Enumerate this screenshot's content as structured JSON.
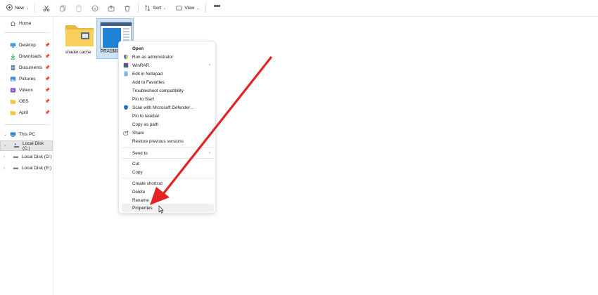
{
  "toolbar": {
    "new_label": "New",
    "sort_label": "Sort",
    "view_label": "View"
  },
  "sidebar": {
    "home": "Home",
    "quick_access": [
      {
        "label": "Desktop",
        "icon": "desktop-icon"
      },
      {
        "label": "Downloads",
        "icon": "downloads-icon"
      },
      {
        "label": "Documents",
        "icon": "documents-icon"
      },
      {
        "label": "Pictures",
        "icon": "pictures-icon"
      },
      {
        "label": "Videos",
        "icon": "videos-icon"
      },
      {
        "label": "OBS",
        "icon": "folder-icon"
      },
      {
        "label": "April",
        "icon": "folder-icon"
      }
    ],
    "this_pc": "This PC",
    "drives": [
      {
        "label": "Local Disk (C:)"
      },
      {
        "label": "Local Disk (D:)"
      },
      {
        "label": "Local Disk (E:)"
      }
    ]
  },
  "files": [
    {
      "label": "shader.cache",
      "icon": "folder-icon"
    },
    {
      "label": "PRAGMA",
      "icon": "document-file-icon"
    }
  ],
  "context_menu": {
    "items": [
      {
        "label": "Open"
      },
      {
        "label": "Run as administrator",
        "icon": "shield-icon"
      },
      {
        "label": "WinRAR",
        "icon": "winrar-icon",
        "submenu": true
      },
      {
        "label": "Edit in Notepad",
        "icon": "notepad-icon"
      },
      {
        "label": "Add to Favorites"
      },
      {
        "label": "Troubleshoot compatibility"
      },
      {
        "label": "Pin to Start"
      },
      {
        "label": "Scan with Microsoft Defender...",
        "icon": "defender-icon"
      },
      {
        "label": "Pin to taskbar"
      },
      {
        "label": "Copy as path"
      },
      {
        "label": "Share",
        "icon": "share-icon"
      },
      {
        "label": "Restore previous versions"
      },
      {
        "label": "Send to",
        "submenu": true
      },
      {
        "label": "Cut"
      },
      {
        "label": "Copy"
      },
      {
        "label": "Create shortcut"
      },
      {
        "label": "Delete"
      },
      {
        "label": "Rename"
      },
      {
        "label": "Properties"
      }
    ]
  },
  "colors": {
    "accent": "#0067c0",
    "annotation_arrow": "#e02424",
    "folder": "#f8c948",
    "selection": "#cfe3f7"
  }
}
